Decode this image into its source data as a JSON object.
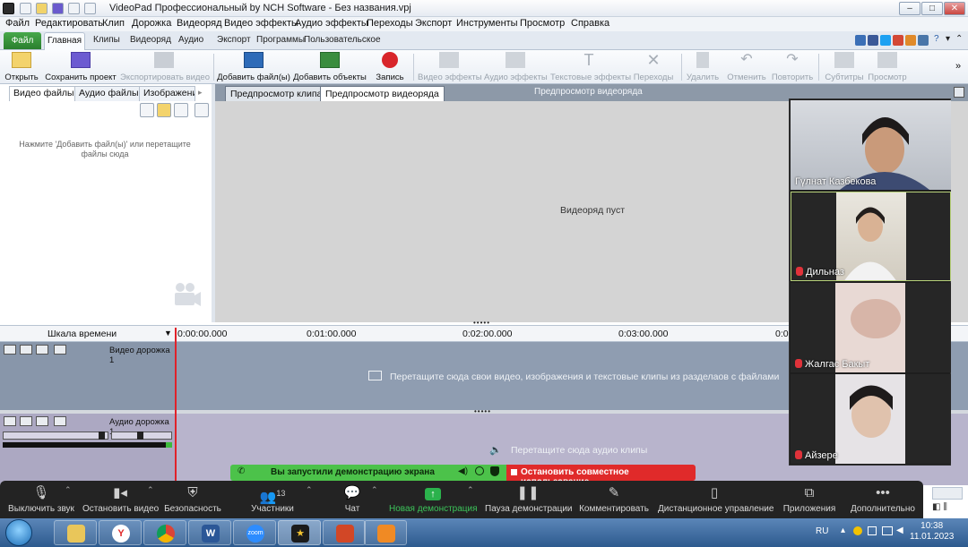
{
  "window": {
    "title": "VideoPad Профессиональный by NCH Software - Без названия.vpj"
  },
  "menu": [
    "Файл",
    "Редактировать",
    "Клип",
    "Дорожка",
    "Видеоряд",
    "Видео эффекты",
    "Аудио эффекты",
    "Переходы",
    "Экспорт",
    "Инструменты",
    "Просмотр",
    "Справка"
  ],
  "ribbon_tabs": {
    "file": "Файл",
    "home": "Главная",
    "others": [
      "Клипы",
      "Видеоряд",
      "Аудио",
      "Экспорт",
      "Программы",
      "Пользовательское"
    ]
  },
  "ribbon": {
    "open": "Открыть",
    "save_project": "Сохранить проект",
    "export_video": "Экспортировать видео",
    "add_files": "Добавить файл(ы)",
    "add_objects": "Добавить объекты",
    "record": "Запись",
    "video_effects": "Видео эффекты",
    "audio_effects": "Аудио эффекты",
    "text_effects": "Текстовые эффекты",
    "transitions": "Переходы",
    "delete": "Удалить",
    "undo": "Отменить",
    "redo": "Повторить",
    "subtitles": "Субтитры",
    "preview": "Просмотр"
  },
  "left_panel": {
    "tabs": [
      "Видео файлы",
      "Аудио файлы",
      "Изображени"
    ],
    "hint": "Нажмите 'Добавить файл(ы)' или перетащите файлы сюда"
  },
  "preview": {
    "tab_clip": "Предпросмотр клипа",
    "tab_sequence": "Предпросмотр видеоряда",
    "title": "Предпросмотр видеоряда",
    "empty": "Видеоряд пуст"
  },
  "timeline": {
    "label": "Шкала времени",
    "ticks": [
      "0:00:00.000",
      "0:01:00.000",
      "0:02:00.000",
      "0:03:00.000",
      "0:0"
    ],
    "video_track": "Видео дорожка 1",
    "video_hint": "Перетащите сюда свои видео, изображения и текстовые клипы из разделаов с файлами",
    "audio_track": "Аудио дорожка 1",
    "audio_hint": "Перетащите сюда аудио клипы"
  },
  "participants": [
    {
      "name": "Гүлнат Казбекова",
      "muted": false
    },
    {
      "name": "Дильназ",
      "muted": true
    },
    {
      "name": "Жалгас Бакыт",
      "muted": true
    },
    {
      "name": "Айзере",
      "muted": true
    }
  ],
  "share_banner": {
    "message": "Вы запустили демонстрацию экрана",
    "stop": "Остановить совместное использование"
  },
  "zoom_toolbar": {
    "mute": "Выключить звук",
    "stop_video": "Остановить видео",
    "security": "Безопасность",
    "participants": "Участники",
    "participants_count": "13",
    "chat": "Чат",
    "new_share": "Новая демонстрация",
    "pause_share": "Пауза демонстрации",
    "annotate": "Комментировать",
    "remote_control": "Дистанционное управление",
    "apps": "Приложения",
    "more": "Дополнительно"
  },
  "taskbar": {
    "language": "RU",
    "time": "10:38",
    "date": "11.01.2023",
    "zoom_app_label": "zoom"
  },
  "colors": {
    "share_green": "#4cc24a",
    "stop_red": "#e02a2a",
    "playhead": "#e0222a",
    "file_tab": "#2e8b32"
  }
}
